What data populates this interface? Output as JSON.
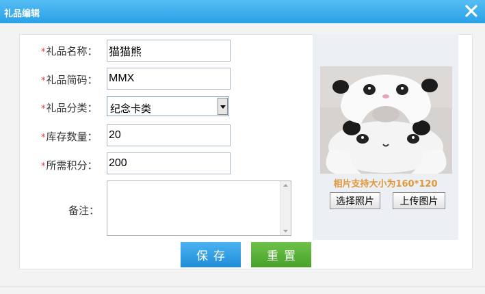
{
  "dialog": {
    "title": "礼品编辑",
    "close_icon": "close-icon"
  },
  "form": {
    "name": {
      "label": "礼品名称：",
      "value": "猫猫熊"
    },
    "code": {
      "label": "礼品简码：",
      "value": "MMX"
    },
    "category": {
      "label": "礼品分类：",
      "selected": "纪念卡类"
    },
    "stock": {
      "label": "库存数量：",
      "value": "20"
    },
    "points": {
      "label": "所需积分：",
      "value": "200"
    },
    "note": {
      "label": "备注：",
      "value": ""
    },
    "required_mark": "*"
  },
  "photo": {
    "hint": "相片支持大小为160*120",
    "select_label": "选择照片",
    "upload_label": "上传图片"
  },
  "actions": {
    "save_label": "保存",
    "reset_label": "重置"
  },
  "colors": {
    "title_bar": "#2aa1e6",
    "required": "#e43c3c",
    "hint": "#e2973a",
    "save": "#1f8ed8",
    "reset": "#47a229"
  }
}
